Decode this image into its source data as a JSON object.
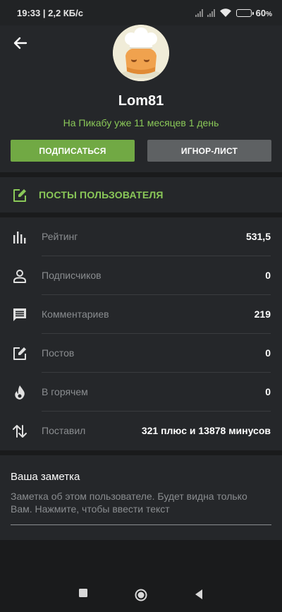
{
  "status": {
    "time": "19:33",
    "speed": "2,2 КБ/с",
    "battery": "60",
    "battery_level": 0.6
  },
  "profile": {
    "username": "Lom81",
    "since": "На Пикабу уже 11 месяцев 1 день",
    "subscribe_label": "ПОДПИСАТЬСЯ",
    "ignore_label": "ИГНОР-ЛИСТ"
  },
  "posts_link": {
    "label": "ПОСТЫ ПОЛЬЗОВАТЕЛЯ",
    "icon": "edit-icon"
  },
  "stats": [
    {
      "label": "Рейтинг",
      "value": "531,5",
      "icon": "rating-bars-icon"
    },
    {
      "label": "Подписчиков",
      "value": "0",
      "icon": "person-icon"
    },
    {
      "label": "Комментариев",
      "value": "219",
      "icon": "comment-icon"
    },
    {
      "label": "Постов",
      "value": "0",
      "icon": "edit-icon"
    },
    {
      "label": "В горячем",
      "value": "0",
      "icon": "fire-icon"
    },
    {
      "label": "Поставил",
      "value": "321 плюс и 13878 минусов",
      "icon": "swap-vertical-icon"
    }
  ],
  "note": {
    "title": "Ваша заметка",
    "hint": "Заметка об этом пользователе. Будет видна только Вам. Нажмите, чтобы ввести текст"
  },
  "colors": {
    "accent": "#71a944",
    "accent_text": "#8ac858",
    "panel": "#25272a",
    "background": "#1a1b1c"
  }
}
